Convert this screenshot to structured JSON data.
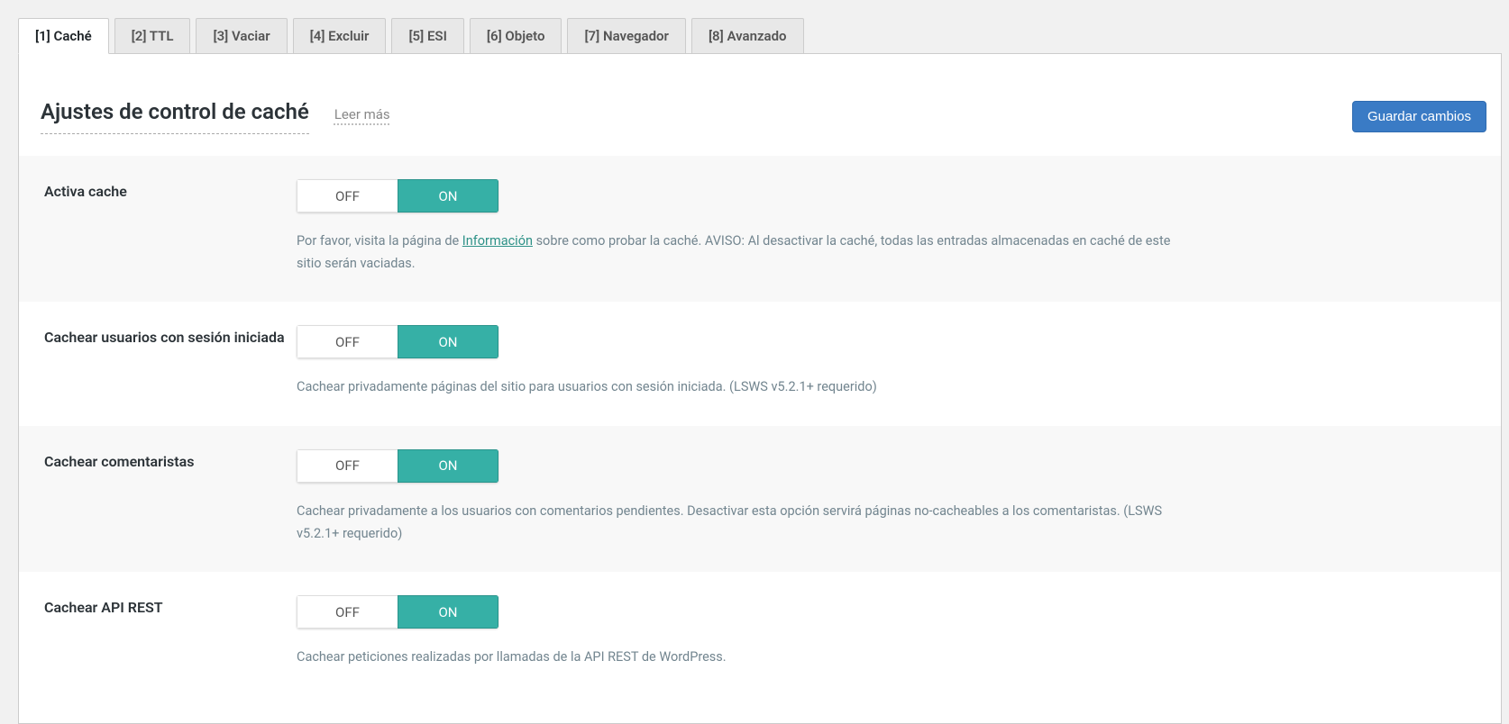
{
  "tabs": [
    {
      "label": "[1] Caché",
      "active": true
    },
    {
      "label": "[2] TTL",
      "active": false
    },
    {
      "label": "[3] Vaciar",
      "active": false
    },
    {
      "label": "[4] Excluir",
      "active": false
    },
    {
      "label": "[5] ESI",
      "active": false
    },
    {
      "label": "[6] Objeto",
      "active": false
    },
    {
      "label": "[7] Navegador",
      "active": false
    },
    {
      "label": "[8] Avanzado",
      "active": false
    }
  ],
  "header": {
    "title": "Ajustes de control de caché",
    "learn_more": "Leer más",
    "save_button": "Guardar cambios"
  },
  "toggle_labels": {
    "off": "OFF",
    "on": "ON"
  },
  "settings": [
    {
      "name": "enable-cache",
      "label": "Activa cache",
      "value": "on",
      "desc_prefix": "Por favor, visita la página de ",
      "desc_link": "Información",
      "desc_suffix": " sobre como probar la caché. AVISO: Al desactivar la caché, todas las entradas almacenadas en caché de este sitio serán vaciadas."
    },
    {
      "name": "cache-logged-in",
      "label": "Cachear usuarios con sesión iniciada",
      "value": "on",
      "desc": "Cachear privadamente páginas del sitio para usuarios con sesión iniciada. (LSWS v5.2.1+ requerido)"
    },
    {
      "name": "cache-commenters",
      "label": "Cachear comentaristas",
      "value": "on",
      "desc": "Cachear privadamente a los usuarios con comentarios pendientes. Desactivar esta opción servirá páginas no-cacheables a los comentaristas. (LSWS v5.2.1+ requerido)"
    },
    {
      "name": "cache-rest-api",
      "label": "Cachear API REST",
      "value": "on",
      "desc": "Cachear peticiones realizadas por llamadas de la API REST de WordPress."
    }
  ]
}
